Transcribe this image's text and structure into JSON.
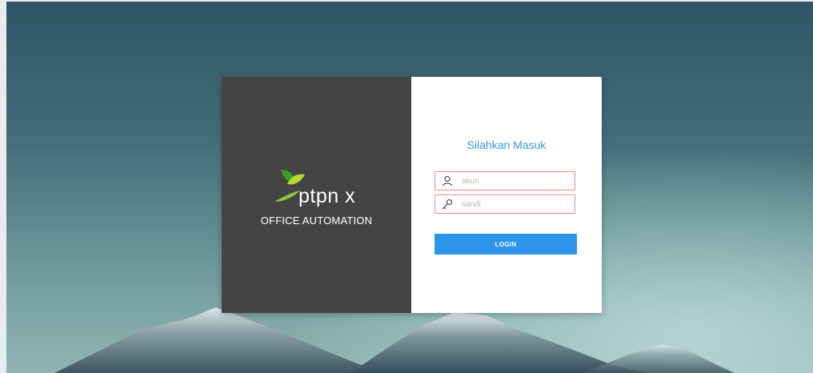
{
  "brand": {
    "logo_text": "ptpn x",
    "subtitle": "OFFICE AUTOMATION"
  },
  "login_form": {
    "title": "Silahkan Masuk",
    "username": {
      "placeholder": "akun",
      "value": "",
      "icon": "user-icon"
    },
    "password": {
      "placeholder": "sandi",
      "value": "",
      "icon": "key-icon"
    },
    "submit_label": "LOGIN"
  },
  "colors": {
    "left_panel": "#444444",
    "title_blue": "#3a9ad9",
    "button_blue": "#2d95ea",
    "field_border": "#e98c8c",
    "logo_green_light": "#b6d82b",
    "logo_green_dark": "#3a9a2c"
  }
}
